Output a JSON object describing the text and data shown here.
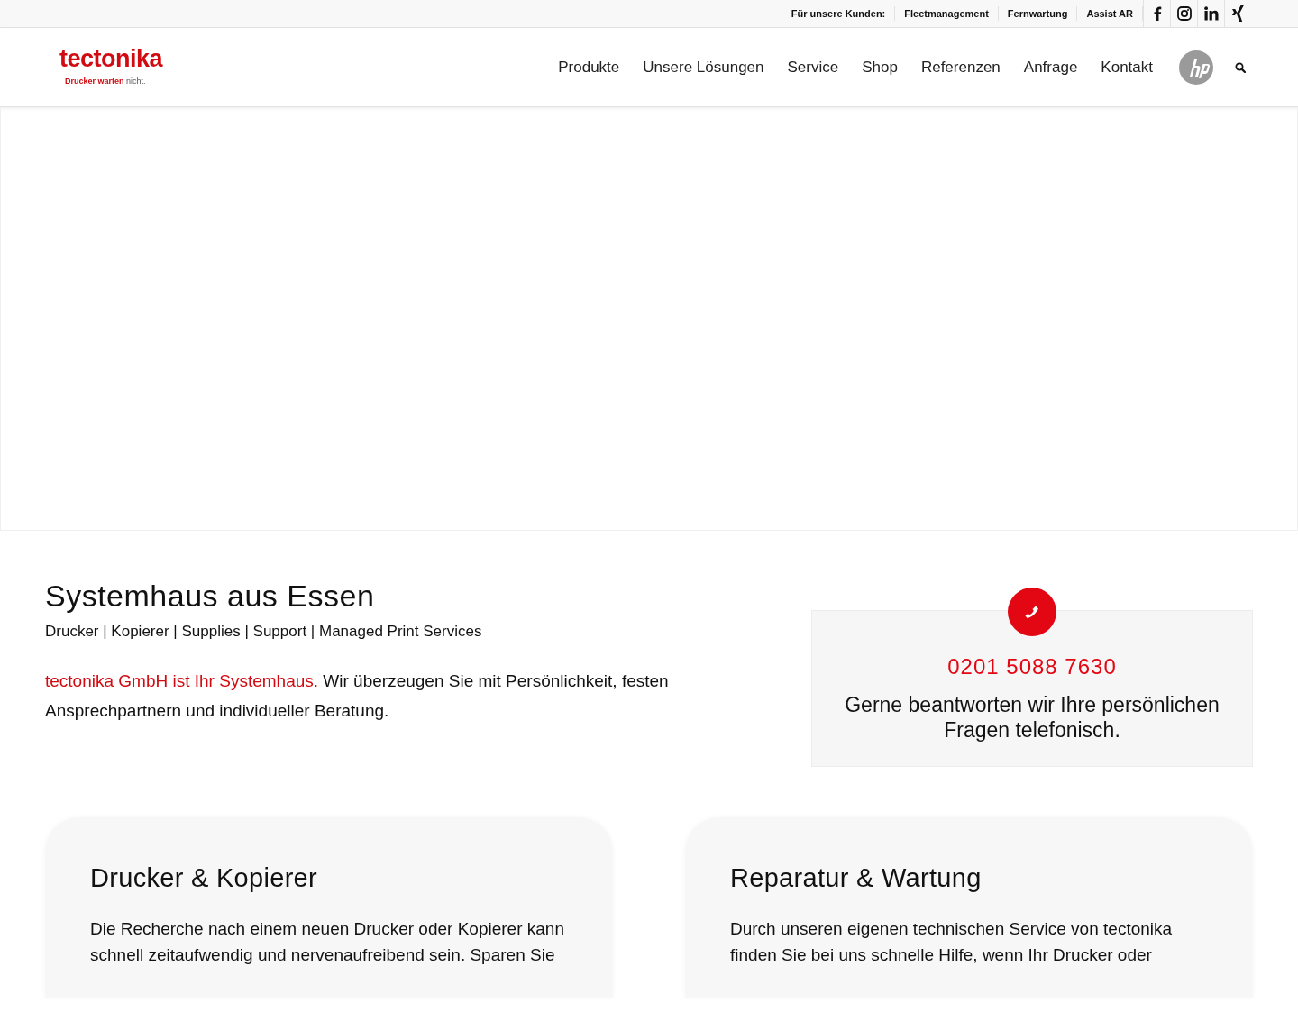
{
  "topbar": {
    "label": "Für unsere Kunden:",
    "links": [
      "Fleetmanagement",
      "Fernwartung",
      "Assist AR"
    ],
    "social": [
      {
        "kind": "facebook"
      },
      {
        "kind": "instagram"
      },
      {
        "kind": "linkedin"
      },
      {
        "kind": "xing"
      }
    ]
  },
  "logo": {
    "name": "tectonika",
    "tagline_main": "Drucker warten",
    "tagline_end": "nicht."
  },
  "nav": {
    "items": [
      "Produkte",
      "Unsere Lösungen",
      "Service",
      "Shop",
      "Referenzen",
      "Anfrage",
      "Kontakt"
    ]
  },
  "intro": {
    "title": "Systemhaus aus Essen",
    "subtitle": "Drucker | Kopierer | Supplies | Support | Managed Print Services",
    "link": "tectonika GmbH ist Ihr Systemhaus.",
    "text": "Wir überzeugen Sie mit Persönlichkeit, festen Ansprechpartnern und individueller Beratung."
  },
  "phone_box": {
    "number": "0201 5088 7630",
    "text": "Gerne beantworten wir Ihre persönlichen Fragen telefonisch."
  },
  "cards": [
    {
      "title": "Drucker & Kopierer",
      "text": "Die Recherche nach einem neuen Drucker oder Kopierer kann schnell zeitaufwendig und nervenaufreibend sein. Sparen Sie"
    },
    {
      "title": "Reparatur & Wartung",
      "text": "Durch unseren eigenen technischen Service von tectonika finden Sie bei uns schnelle Hilfe, wenn Ihr Drucker oder"
    }
  ]
}
